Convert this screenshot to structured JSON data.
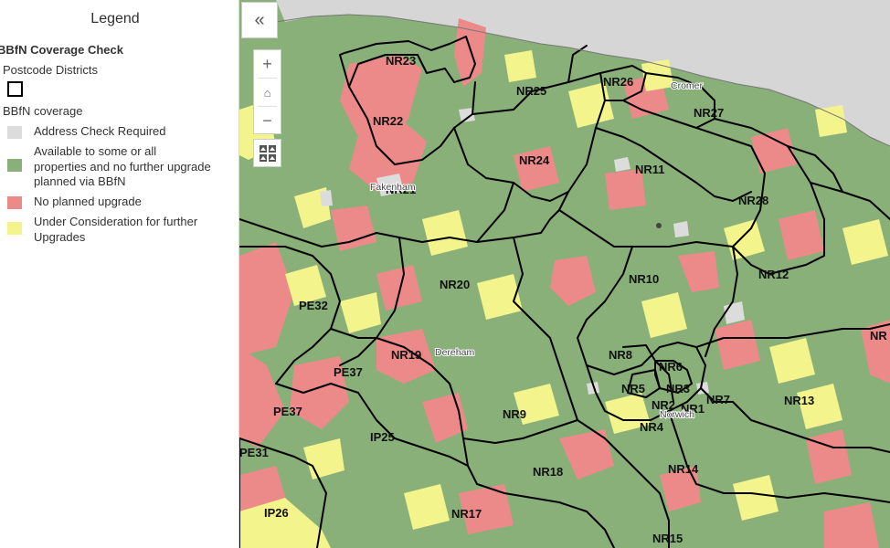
{
  "legend": {
    "title": "Legend",
    "layer_title": "BBfN Coverage Check",
    "postcode_sublayer": "Postcode Districts",
    "coverage_sublayer": "BBfN coverage",
    "classes": [
      {
        "label": "Address Check Required",
        "color": "#dcdcdc"
      },
      {
        "label": "Available to some or all properties and no further upgrade planned via BBfN",
        "color": "#88b078"
      },
      {
        "label": "No planned upgrade",
        "color": "#ec8a8a"
      },
      {
        "label": "Under Consideration for further Upgrades",
        "color": "#f4f48c"
      }
    ]
  },
  "controls": {
    "collapse_icon": "«",
    "zoom_in": "+",
    "home": "⌂",
    "zoom_out": "−"
  },
  "map": {
    "colors": {
      "available": "#88b078",
      "no_upgrade": "#ec8a8a",
      "consideration": "#f4f48c",
      "check": "#dcdcdc",
      "sea": "#d6d6d6",
      "boundary": "#000000"
    },
    "district_labels": [
      "NR23",
      "NR26",
      "NR25",
      "NR27",
      "NR22",
      "NR24",
      "NR11",
      "NR28",
      "NR12",
      "NR20",
      "NR10",
      "PE32",
      "NR19",
      "NR8",
      "NR6",
      "PE37",
      "NR5",
      "NR3",
      "NR2",
      "NR1",
      "NR7",
      "NR13",
      "PE37",
      "IP25",
      "NR9",
      "NR4",
      "NR18",
      "NR14",
      "PE31",
      "IP26",
      "NR17",
      "NR15",
      "NR",
      "NR21"
    ],
    "town_labels": [
      "Cromer",
      "Fakenham",
      "Dereham",
      "Norwich"
    ]
  }
}
